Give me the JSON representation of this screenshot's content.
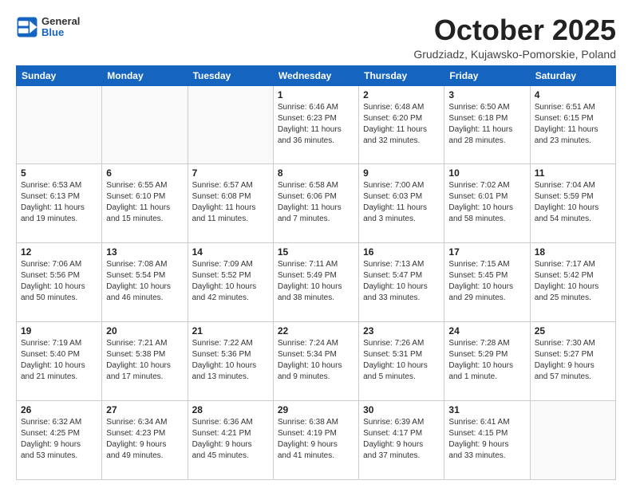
{
  "logo": {
    "general": "General",
    "blue": "Blue"
  },
  "header": {
    "title": "October 2025",
    "subtitle": "Grudziadz, Kujawsko-Pomorskie, Poland"
  },
  "weekdays": [
    "Sunday",
    "Monday",
    "Tuesday",
    "Wednesday",
    "Thursday",
    "Friday",
    "Saturday"
  ],
  "weeks": [
    [
      {
        "day": "",
        "info": ""
      },
      {
        "day": "",
        "info": ""
      },
      {
        "day": "",
        "info": ""
      },
      {
        "day": "1",
        "info": "Sunrise: 6:46 AM\nSunset: 6:23 PM\nDaylight: 11 hours\nand 36 minutes."
      },
      {
        "day": "2",
        "info": "Sunrise: 6:48 AM\nSunset: 6:20 PM\nDaylight: 11 hours\nand 32 minutes."
      },
      {
        "day": "3",
        "info": "Sunrise: 6:50 AM\nSunset: 6:18 PM\nDaylight: 11 hours\nand 28 minutes."
      },
      {
        "day": "4",
        "info": "Sunrise: 6:51 AM\nSunset: 6:15 PM\nDaylight: 11 hours\nand 23 minutes."
      }
    ],
    [
      {
        "day": "5",
        "info": "Sunrise: 6:53 AM\nSunset: 6:13 PM\nDaylight: 11 hours\nand 19 minutes."
      },
      {
        "day": "6",
        "info": "Sunrise: 6:55 AM\nSunset: 6:10 PM\nDaylight: 11 hours\nand 15 minutes."
      },
      {
        "day": "7",
        "info": "Sunrise: 6:57 AM\nSunset: 6:08 PM\nDaylight: 11 hours\nand 11 minutes."
      },
      {
        "day": "8",
        "info": "Sunrise: 6:58 AM\nSunset: 6:06 PM\nDaylight: 11 hours\nand 7 minutes."
      },
      {
        "day": "9",
        "info": "Sunrise: 7:00 AM\nSunset: 6:03 PM\nDaylight: 11 hours\nand 3 minutes."
      },
      {
        "day": "10",
        "info": "Sunrise: 7:02 AM\nSunset: 6:01 PM\nDaylight: 10 hours\nand 58 minutes."
      },
      {
        "day": "11",
        "info": "Sunrise: 7:04 AM\nSunset: 5:59 PM\nDaylight: 10 hours\nand 54 minutes."
      }
    ],
    [
      {
        "day": "12",
        "info": "Sunrise: 7:06 AM\nSunset: 5:56 PM\nDaylight: 10 hours\nand 50 minutes."
      },
      {
        "day": "13",
        "info": "Sunrise: 7:08 AM\nSunset: 5:54 PM\nDaylight: 10 hours\nand 46 minutes."
      },
      {
        "day": "14",
        "info": "Sunrise: 7:09 AM\nSunset: 5:52 PM\nDaylight: 10 hours\nand 42 minutes."
      },
      {
        "day": "15",
        "info": "Sunrise: 7:11 AM\nSunset: 5:49 PM\nDaylight: 10 hours\nand 38 minutes."
      },
      {
        "day": "16",
        "info": "Sunrise: 7:13 AM\nSunset: 5:47 PM\nDaylight: 10 hours\nand 33 minutes."
      },
      {
        "day": "17",
        "info": "Sunrise: 7:15 AM\nSunset: 5:45 PM\nDaylight: 10 hours\nand 29 minutes."
      },
      {
        "day": "18",
        "info": "Sunrise: 7:17 AM\nSunset: 5:42 PM\nDaylight: 10 hours\nand 25 minutes."
      }
    ],
    [
      {
        "day": "19",
        "info": "Sunrise: 7:19 AM\nSunset: 5:40 PM\nDaylight: 10 hours\nand 21 minutes."
      },
      {
        "day": "20",
        "info": "Sunrise: 7:21 AM\nSunset: 5:38 PM\nDaylight: 10 hours\nand 17 minutes."
      },
      {
        "day": "21",
        "info": "Sunrise: 7:22 AM\nSunset: 5:36 PM\nDaylight: 10 hours\nand 13 minutes."
      },
      {
        "day": "22",
        "info": "Sunrise: 7:24 AM\nSunset: 5:34 PM\nDaylight: 10 hours\nand 9 minutes."
      },
      {
        "day": "23",
        "info": "Sunrise: 7:26 AM\nSunset: 5:31 PM\nDaylight: 10 hours\nand 5 minutes."
      },
      {
        "day": "24",
        "info": "Sunrise: 7:28 AM\nSunset: 5:29 PM\nDaylight: 10 hours\nand 1 minute."
      },
      {
        "day": "25",
        "info": "Sunrise: 7:30 AM\nSunset: 5:27 PM\nDaylight: 9 hours\nand 57 minutes."
      }
    ],
    [
      {
        "day": "26",
        "info": "Sunrise: 6:32 AM\nSunset: 4:25 PM\nDaylight: 9 hours\nand 53 minutes."
      },
      {
        "day": "27",
        "info": "Sunrise: 6:34 AM\nSunset: 4:23 PM\nDaylight: 9 hours\nand 49 minutes."
      },
      {
        "day": "28",
        "info": "Sunrise: 6:36 AM\nSunset: 4:21 PM\nDaylight: 9 hours\nand 45 minutes."
      },
      {
        "day": "29",
        "info": "Sunrise: 6:38 AM\nSunset: 4:19 PM\nDaylight: 9 hours\nand 41 minutes."
      },
      {
        "day": "30",
        "info": "Sunrise: 6:39 AM\nSunset: 4:17 PM\nDaylight: 9 hours\nand 37 minutes."
      },
      {
        "day": "31",
        "info": "Sunrise: 6:41 AM\nSunset: 4:15 PM\nDaylight: 9 hours\nand 33 minutes."
      },
      {
        "day": "",
        "info": ""
      }
    ]
  ]
}
